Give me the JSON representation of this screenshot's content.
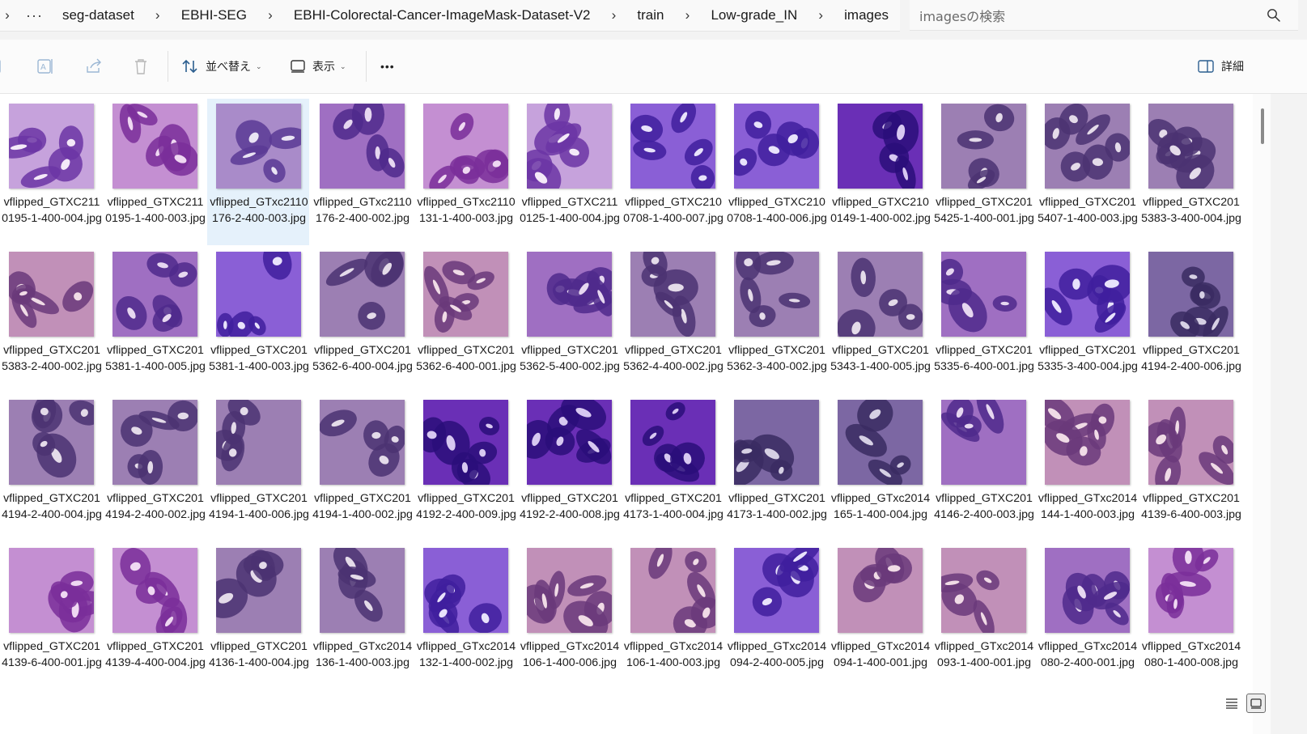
{
  "breadcrumb": {
    "more_label": "···",
    "segments": [
      "seg-dataset",
      "EBHI-SEG",
      "EBHI-Colorectal-Cancer-ImageMask-Dataset-V2",
      "train",
      "Low-grade_IN",
      "images"
    ]
  },
  "search": {
    "placeholder": "imagesの検索"
  },
  "toolbar": {
    "sort_label": "並べ替え",
    "view_label": "表示",
    "more_label": "•••",
    "details_label": "詳細"
  },
  "colors": {
    "selection": "#e5f1fb",
    "stain_purple": "#6b3aa0",
    "stain_pink": "#d58fc9"
  },
  "files": [
    {
      "name": "vflipped_GTXC2110195-1-400-004.jpg",
      "tone": 0
    },
    {
      "name": "vflipped_GTXC2110195-1-400-003.jpg",
      "tone": 1
    },
    {
      "name": "vflipped_GTxc2110176-2-400-003.jpg",
      "tone": 2,
      "selected": true
    },
    {
      "name": "vflipped_GTxc2110176-2-400-002.jpg",
      "tone": 3
    },
    {
      "name": "vflipped_GTxc2110131-1-400-003.jpg",
      "tone": 1
    },
    {
      "name": "vflipped_GTXC2110125-1-400-004.jpg",
      "tone": 0
    },
    {
      "name": "vflipped_GTXC2100708-1-400-007.jpg",
      "tone": 4
    },
    {
      "name": "vflipped_GTXC2100708-1-400-006.jpg",
      "tone": 4
    },
    {
      "name": "vflipped_GTXC2100149-1-400-002.jpg",
      "tone": 5
    },
    {
      "name": "vflipped_GTXC2015425-1-400-001.jpg",
      "tone": 6
    },
    {
      "name": "vflipped_GTXC2015407-1-400-003.jpg",
      "tone": 6
    },
    {
      "name": "vflipped_GTXC2015383-3-400-004.jpg",
      "tone": 6
    },
    {
      "name": "vflipped_GTXC2015383-2-400-002.jpg",
      "tone": 7
    },
    {
      "name": "vflipped_GTXC2015381-1-400-005.jpg",
      "tone": 3
    },
    {
      "name": "vflipped_GTXC2015381-1-400-003.jpg",
      "tone": 4
    },
    {
      "name": "vflipped_GTXC2015362-6-400-004.jpg",
      "tone": 6
    },
    {
      "name": "vflipped_GTXC2015362-6-400-001.jpg",
      "tone": 7
    },
    {
      "name": "vflipped_GTXC2015362-5-400-002.jpg",
      "tone": 3
    },
    {
      "name": "vflipped_GTXC2015362-4-400-002.jpg",
      "tone": 6
    },
    {
      "name": "vflipped_GTXC2015362-3-400-002.jpg",
      "tone": 6
    },
    {
      "name": "vflipped_GTXC2015343-1-400-005.jpg",
      "tone": 6
    },
    {
      "name": "vflipped_GTXC2015335-6-400-001.jpg",
      "tone": 3
    },
    {
      "name": "vflipped_GTXC2015335-3-400-004.jpg",
      "tone": 4
    },
    {
      "name": "vflipped_GTXC2014194-2-400-006.jpg",
      "tone": 8
    },
    {
      "name": "vflipped_GTXC2014194-2-400-004.jpg",
      "tone": 6
    },
    {
      "name": "vflipped_GTXC2014194-2-400-002.jpg",
      "tone": 6
    },
    {
      "name": "vflipped_GTXC2014194-1-400-006.jpg",
      "tone": 6
    },
    {
      "name": "vflipped_GTXC2014194-1-400-002.jpg",
      "tone": 6
    },
    {
      "name": "vflipped_GTXC2014192-2-400-009.jpg",
      "tone": 5
    },
    {
      "name": "vflipped_GTXC2014192-2-400-008.jpg",
      "tone": 5
    },
    {
      "name": "vflipped_GTXC2014173-1-400-004.jpg",
      "tone": 5
    },
    {
      "name": "vflipped_GTXC2014173-1-400-002.jpg",
      "tone": 8
    },
    {
      "name": "vflipped_GTxc2014165-1-400-004.jpg",
      "tone": 8
    },
    {
      "name": "vflipped_GTXC2014146-2-400-003.jpg",
      "tone": 3
    },
    {
      "name": "vflipped_GTxc2014144-1-400-003.jpg",
      "tone": 7
    },
    {
      "name": "vflipped_GTXC2014139-6-400-003.jpg",
      "tone": 7
    },
    {
      "name": "vflipped_GTXC2014139-6-400-001.jpg",
      "tone": 1
    },
    {
      "name": "vflipped_GTXC2014139-4-400-004.jpg",
      "tone": 1
    },
    {
      "name": "vflipped_GTXC2014136-1-400-004.jpg",
      "tone": 6
    },
    {
      "name": "vflipped_GTxc2014136-1-400-003.jpg",
      "tone": 6
    },
    {
      "name": "vflipped_GTxc2014132-1-400-002.jpg",
      "tone": 4
    },
    {
      "name": "vflipped_GTxc2014106-1-400-006.jpg",
      "tone": 7
    },
    {
      "name": "vflipped_GTxc2014106-1-400-003.jpg",
      "tone": 7
    },
    {
      "name": "vflipped_GTxc2014094-2-400-005.jpg",
      "tone": 4
    },
    {
      "name": "vflipped_GTxc2014094-1-400-001.jpg",
      "tone": 7
    },
    {
      "name": "vflipped_GTxc2014093-1-400-001.jpg",
      "tone": 7
    },
    {
      "name": "vflipped_GTxc2014080-2-400-001.jpg",
      "tone": 3
    },
    {
      "name": "vflipped_GTxc2014080-1-400-008.jpg",
      "tone": 1
    }
  ]
}
